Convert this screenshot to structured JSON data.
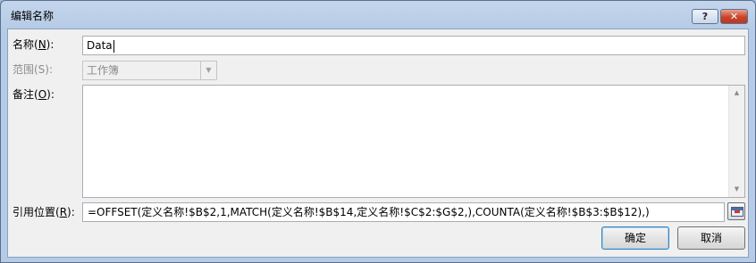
{
  "dialog": {
    "title": "编辑名称",
    "help_label": "?",
    "close_label": "✕"
  },
  "name_field": {
    "label_prefix": "名称(",
    "label_key": "N",
    "label_suffix": "):",
    "value": "Data"
  },
  "scope_field": {
    "label": "范围(S):",
    "value": "工作簿",
    "dropdown_arrow": "▼"
  },
  "comment_field": {
    "label_prefix": "备注(",
    "label_key": "O",
    "label_suffix": "):",
    "value": "",
    "scroll_up": "▲",
    "scroll_down": "▼"
  },
  "refers_to_field": {
    "label_prefix": "引用位置(",
    "label_key": "R",
    "label_suffix": "):",
    "value": "=OFFSET(定义名称!$B$2,1,MATCH(定义名称!$B$14,定义名称!$C$2:$G$2,),COUNTA(定义名称!$B$3:$B$12),)"
  },
  "buttons": {
    "ok_label": "确定",
    "cancel_label": "取消"
  },
  "icons": {
    "help": "question-mark-icon",
    "close": "close-icon",
    "collapse": "range-collapse-icon"
  },
  "colors": {
    "frame": "#b6cbe6",
    "client": "#f0f0f0",
    "close_button": "#c8432a",
    "disabled_text": "#8c8c8c"
  }
}
